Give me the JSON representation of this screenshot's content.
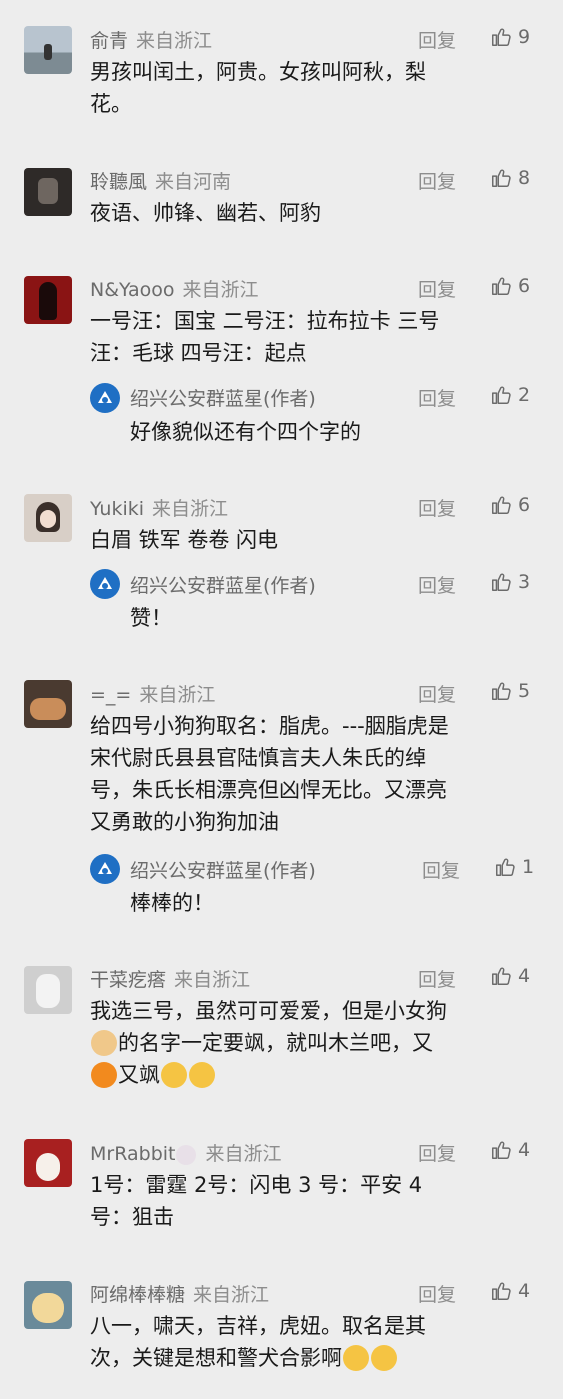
{
  "comments": [
    {
      "name": "俞青",
      "location": "来自浙江",
      "reply": "回复",
      "likes": "9",
      "lines": [
        "男孩叫闰土，阿贵。女孩叫阿秋，梨",
        "花。"
      ]
    },
    {
      "name": "聆聽風",
      "location": "来自河南",
      "reply": "回复",
      "likes": "8",
      "lines": [
        "夜语、帅锋、幽若、阿豹"
      ]
    },
    {
      "name": "N&Yaooo",
      "location": "来自浙江",
      "reply": "回复",
      "likes": "6",
      "lines": [
        "一号汪：国宝  二号汪：拉布拉卡  三号",
        "汪：毛球  四号汪：起点"
      ]
    },
    {
      "name": "Yukiki",
      "location": "来自浙江",
      "reply": "回复",
      "likes": "6",
      "lines": [
        "白眉 铁军 卷卷 闪电"
      ]
    },
    {
      "name": "=_=",
      "location": "来自浙江",
      "reply": "回复",
      "likes": "5",
      "lines": [
        "给四号小狗狗取名：脂虎。---胭脂虎是",
        "宋代尉氏县县官陆慎言夫人朱氏的绰",
        "号，朱氏长相漂亮但凶悍无比。又漂亮",
        "又勇敢的小狗狗加油"
      ]
    },
    {
      "name": "干菜疙瘩",
      "location": "来自浙江",
      "reply": "回复",
      "likes": "4",
      "lines": [
        "我选三号，虽然可可爱爱，但是小女狗",
        "的名字一定要飒，就叫木兰吧，又",
        "又飒"
      ]
    },
    {
      "name": "MrRabbit",
      "location": "来自浙江",
      "reply": "回复",
      "likes": "4",
      "lines": [
        "1号：雷霆 2号：闪电 3 号：平安  4",
        "号：狙击"
      ]
    },
    {
      "name": "阿绵棒棒糖",
      "location": "来自浙江",
      "reply": "回复",
      "likes": "4",
      "lines": [
        "八一，啸天，吉祥，虎妞。取名是其",
        "次，关键是想和警犬合影啊"
      ]
    }
  ],
  "replies": [
    {
      "name": "绍兴公安群蓝星(作者)",
      "reply": "回复",
      "likes": "2",
      "text": "好像貌似还有个四个字的"
    },
    {
      "name": "绍兴公安群蓝星(作者)",
      "reply": "回复",
      "likes": "3",
      "text": "赞！"
    },
    {
      "name": "绍兴公安群蓝星(作者)",
      "reply": "回复",
      "likes": "1",
      "text": "棒棒的！"
    }
  ],
  "colors": {
    "background": "#ededed",
    "name": "#6b6b6b",
    "meta": "#8d8d8d",
    "text": "#1a1a1a",
    "author_logo": "#1f6fc4"
  },
  "icons": {
    "like": "thumbs-up-icon",
    "dog_emoji": "dog-face-emoji",
    "ke_badge": "ke-badge-emoji",
    "tongue_emoji": "crazy-face-emoji"
  }
}
